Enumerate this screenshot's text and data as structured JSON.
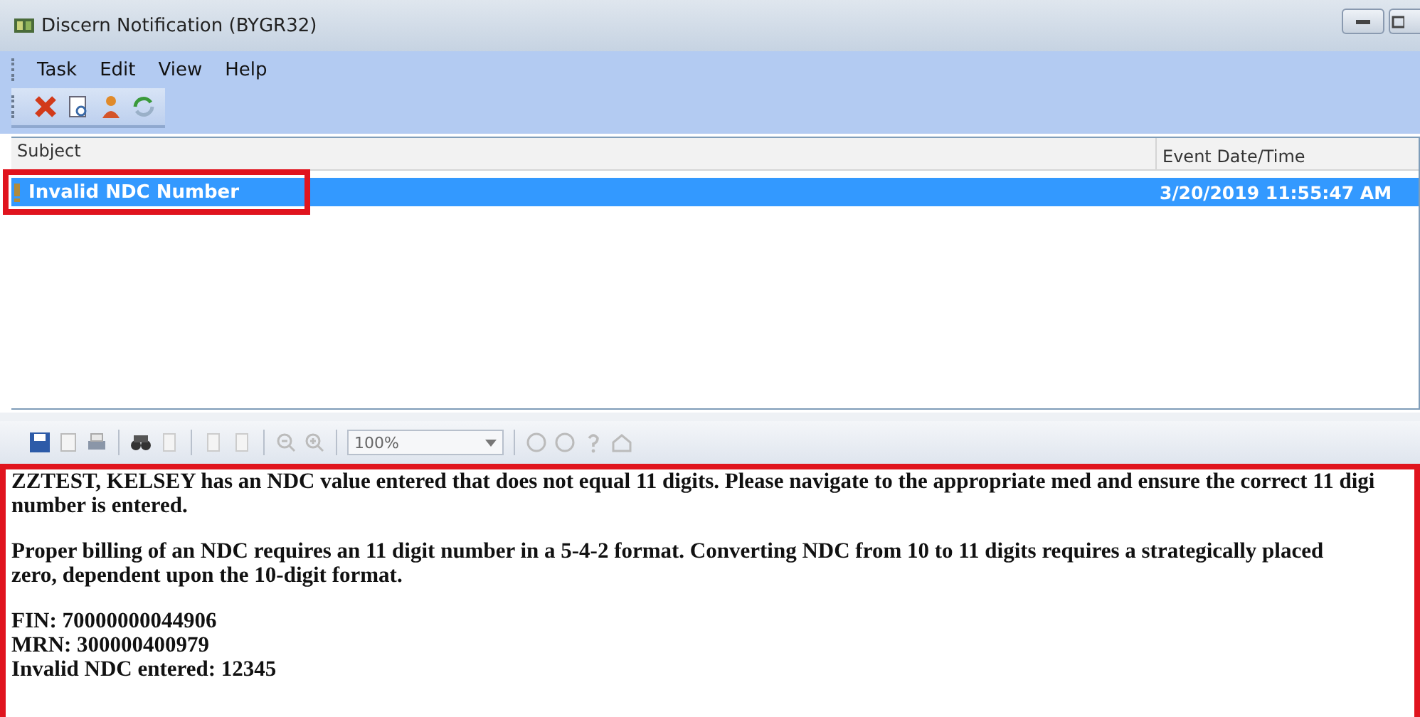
{
  "window": {
    "title": "Discern Notification (BYGR32)"
  },
  "menu": [
    {
      "label": "Task"
    },
    {
      "label": "Edit"
    },
    {
      "label": "View"
    },
    {
      "label": "Help"
    }
  ],
  "list": {
    "columns": [
      "Subject",
      "Event Date/Time"
    ],
    "rows": [
      {
        "subject": "Invalid NDC Number",
        "event_date_time": "3/20/2019 11:55:47 AM",
        "selected": true,
        "important": true
      }
    ]
  },
  "viewer": {
    "zoom": "100%",
    "paragraphs": [
      {
        "lines": [
          "ZZTEST, KELSEY has an NDC value entered that does not equal 11 digits. Please navigate to the appropriate med and ensure the correct 11 digi",
          "number is entered."
        ]
      },
      {
        "lines": [
          "Proper billing of an NDC requires an 11 digit number in a 5-4-2 format. Converting NDC from 10 to 11 digits requires a strategically placed",
          "zero, dependent upon the 10-digit format."
        ]
      },
      {
        "lines": [
          "FIN: 70000000044906",
          "MRN: 300000400979",
          "Invalid NDC entered: 12345"
        ]
      }
    ]
  }
}
